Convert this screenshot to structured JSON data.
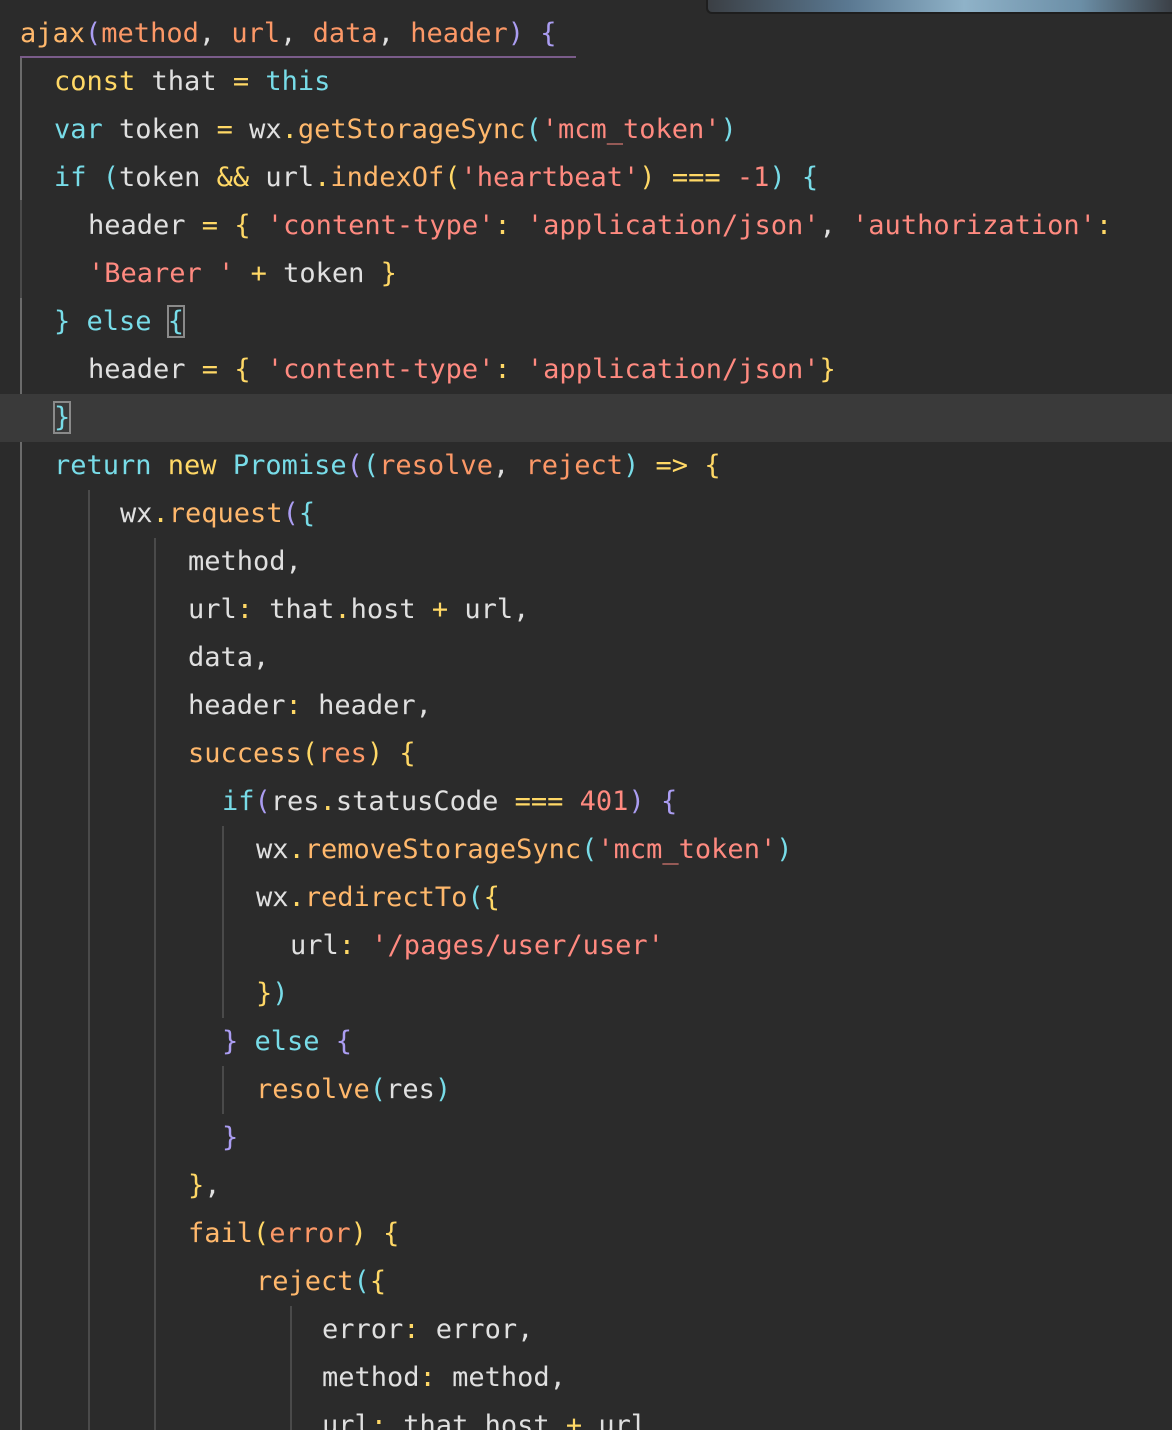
{
  "theme_colors": {
    "background": "#2b2b2b",
    "current_line": "#3a3a3a",
    "keyword": "#ffd866",
    "keyword_alt": "#78dce8",
    "function": "#ffb86c",
    "string": "#ff8a80",
    "param": "#fc9867",
    "punct": "#ab9df2",
    "text": "#e0e0e0"
  },
  "lines": [
    {
      "indent": 20,
      "tokens": [
        [
          "ajax",
          "fn"
        ],
        [
          "(",
          "pp"
        ],
        [
          "method",
          "pa"
        ],
        [
          ", ",
          "tx"
        ],
        [
          "url",
          "pa"
        ],
        [
          ", ",
          "tx"
        ],
        [
          "data",
          "pa"
        ],
        [
          ", ",
          "tx"
        ],
        [
          "header",
          "pa"
        ],
        [
          ") ",
          "pp"
        ],
        [
          "{",
          "pp"
        ]
      ]
    },
    {
      "indent": 54,
      "tokens": [
        [
          "const ",
          "kw"
        ],
        [
          "that ",
          "tx"
        ],
        [
          "= ",
          "op"
        ],
        [
          "this",
          "kb"
        ]
      ]
    },
    {
      "indent": 54,
      "tokens": [
        [
          "var ",
          "kb"
        ],
        [
          "token ",
          "tx"
        ],
        [
          "= ",
          "op"
        ],
        [
          "wx",
          "tx"
        ],
        [
          ".",
          "op"
        ],
        [
          "getStorageSync",
          "fn"
        ],
        [
          "(",
          "pb"
        ],
        [
          "'mcm_token'",
          "st"
        ],
        [
          ")",
          "pb"
        ]
      ]
    },
    {
      "indent": 54,
      "tokens": [
        [
          "if ",
          "kb"
        ],
        [
          "(",
          "pb"
        ],
        [
          "token ",
          "tx"
        ],
        [
          "&& ",
          "op"
        ],
        [
          "url",
          "tx"
        ],
        [
          ".",
          "op"
        ],
        [
          "indexOf",
          "fn"
        ],
        [
          "(",
          "py"
        ],
        [
          "'heartbeat'",
          "st"
        ],
        [
          ") ",
          "py"
        ],
        [
          "=== ",
          "op"
        ],
        [
          "-1",
          "nu"
        ],
        [
          ") ",
          "pb"
        ],
        [
          "{",
          "pb"
        ]
      ]
    },
    {
      "indent": 88,
      "tokens": [
        [
          "header ",
          "tx"
        ],
        [
          "= ",
          "op"
        ],
        [
          "{ ",
          "py"
        ],
        [
          "'content-type'",
          "st"
        ],
        [
          ": ",
          "op"
        ],
        [
          "'application/json'",
          "st"
        ],
        [
          ", ",
          "tx"
        ],
        [
          "'authorization'",
          "st"
        ],
        [
          ":",
          "op"
        ]
      ]
    },
    {
      "indent": 88,
      "tokens": [
        [
          "'Bearer '",
          "st"
        ],
        [
          " + ",
          "op"
        ],
        [
          "token ",
          "tx"
        ],
        [
          "}",
          "py"
        ]
      ]
    },
    {
      "indent": 54,
      "tokens": [
        [
          "} ",
          "pb"
        ],
        [
          "else ",
          "kb"
        ],
        [
          "{",
          "pbm"
        ]
      ]
    },
    {
      "indent": 88,
      "tokens": [
        [
          "header ",
          "tx"
        ],
        [
          "= ",
          "op"
        ],
        [
          "{ ",
          "py"
        ],
        [
          "'content-type'",
          "st"
        ],
        [
          ": ",
          "op"
        ],
        [
          "'application/json'",
          "st"
        ],
        [
          "}",
          "py"
        ]
      ]
    },
    {
      "indent": 54,
      "current": true,
      "tokens": [
        [
          "}",
          "pbm"
        ]
      ]
    },
    {
      "indent": 54,
      "tokens": [
        [
          "return ",
          "kb"
        ],
        [
          "new ",
          "kw"
        ],
        [
          "Promise",
          "kb"
        ],
        [
          "(",
          "pp"
        ],
        [
          "(",
          "pb"
        ],
        [
          "resolve",
          "pa"
        ],
        [
          ", ",
          "tx"
        ],
        [
          "reject",
          "pa"
        ],
        [
          ") ",
          "pb"
        ],
        [
          "=> ",
          "kw"
        ],
        [
          "{",
          "py"
        ]
      ]
    },
    {
      "indent": 120,
      "tokens": [
        [
          "wx",
          "tx"
        ],
        [
          ".",
          "op"
        ],
        [
          "request",
          "fn"
        ],
        [
          "(",
          "pp"
        ],
        [
          "{",
          "pb"
        ]
      ]
    },
    {
      "indent": 188,
      "tokens": [
        [
          "method",
          "tx"
        ],
        [
          ",",
          "tx"
        ]
      ]
    },
    {
      "indent": 188,
      "tokens": [
        [
          "url",
          "tx"
        ],
        [
          ": ",
          "op"
        ],
        [
          "that",
          "tx"
        ],
        [
          ".",
          "op"
        ],
        [
          "host ",
          "tx"
        ],
        [
          "+ ",
          "op"
        ],
        [
          "url",
          "tx"
        ],
        [
          ",",
          "tx"
        ]
      ]
    },
    {
      "indent": 188,
      "tokens": [
        [
          "data",
          "tx"
        ],
        [
          ",",
          "tx"
        ]
      ]
    },
    {
      "indent": 188,
      "tokens": [
        [
          "header",
          "tx"
        ],
        [
          ": ",
          "op"
        ],
        [
          "header",
          "tx"
        ],
        [
          ",",
          "tx"
        ]
      ]
    },
    {
      "indent": 188,
      "tokens": [
        [
          "success",
          "fn"
        ],
        [
          "(",
          "py"
        ],
        [
          "res",
          "pa"
        ],
        [
          ") ",
          "py"
        ],
        [
          "{",
          "py"
        ]
      ]
    },
    {
      "indent": 222,
      "tokens": [
        [
          "if",
          "kb"
        ],
        [
          "(",
          "pp"
        ],
        [
          "res",
          "tx"
        ],
        [
          ".",
          "op"
        ],
        [
          "statusCode ",
          "tx"
        ],
        [
          "=== ",
          "op"
        ],
        [
          "401",
          "nu"
        ],
        [
          ") ",
          "pp"
        ],
        [
          "{",
          "pp"
        ]
      ]
    },
    {
      "indent": 256,
      "tokens": [
        [
          "wx",
          "tx"
        ],
        [
          ".",
          "op"
        ],
        [
          "removeStorageSync",
          "fn"
        ],
        [
          "(",
          "pb"
        ],
        [
          "'mcm_token'",
          "st"
        ],
        [
          ")",
          "pb"
        ]
      ]
    },
    {
      "indent": 256,
      "tokens": [
        [
          "wx",
          "tx"
        ],
        [
          ".",
          "op"
        ],
        [
          "redirectTo",
          "fn"
        ],
        [
          "(",
          "pb"
        ],
        [
          "{",
          "py"
        ]
      ]
    },
    {
      "indent": 290,
      "tokens": [
        [
          "url",
          "tx"
        ],
        [
          ": ",
          "op"
        ],
        [
          "'/pages/user/user'",
          "st"
        ]
      ]
    },
    {
      "indent": 256,
      "tokens": [
        [
          "}",
          "py"
        ],
        [
          ")",
          "pb"
        ]
      ]
    },
    {
      "indent": 222,
      "tokens": [
        [
          "} ",
          "pp"
        ],
        [
          "else ",
          "kb"
        ],
        [
          "{",
          "pp"
        ]
      ]
    },
    {
      "indent": 256,
      "tokens": [
        [
          "resolve",
          "fn"
        ],
        [
          "(",
          "pb"
        ],
        [
          "res",
          "tx"
        ],
        [
          ")",
          "pb"
        ]
      ]
    },
    {
      "indent": 222,
      "tokens": [
        [
          "}",
          "pp"
        ]
      ]
    },
    {
      "indent": 188,
      "tokens": [
        [
          "}",
          "py"
        ],
        [
          ",",
          "tx"
        ]
      ]
    },
    {
      "indent": 188,
      "tokens": [
        [
          "fail",
          "fn"
        ],
        [
          "(",
          "py"
        ],
        [
          "error",
          "pa"
        ],
        [
          ") ",
          "py"
        ],
        [
          "{",
          "py"
        ]
      ]
    },
    {
      "indent": 256,
      "tokens": [
        [
          "reject",
          "fn"
        ],
        [
          "(",
          "pb"
        ],
        [
          "{",
          "py"
        ]
      ]
    },
    {
      "indent": 322,
      "tokens": [
        [
          "error",
          "tx"
        ],
        [
          ": ",
          "op"
        ],
        [
          "error",
          "tx"
        ],
        [
          ",",
          "tx"
        ]
      ]
    },
    {
      "indent": 322,
      "tokens": [
        [
          "method",
          "tx"
        ],
        [
          ": ",
          "op"
        ],
        [
          "method",
          "tx"
        ],
        [
          ",",
          "tx"
        ]
      ]
    },
    {
      "indent": 322,
      "tokens": [
        [
          "url",
          "tx"
        ],
        [
          ": ",
          "op"
        ],
        [
          "that",
          "tx"
        ],
        [
          ".",
          "op"
        ],
        [
          "host ",
          "tx"
        ],
        [
          "+ ",
          "op"
        ],
        [
          "url",
          "tx"
        ]
      ]
    }
  ]
}
